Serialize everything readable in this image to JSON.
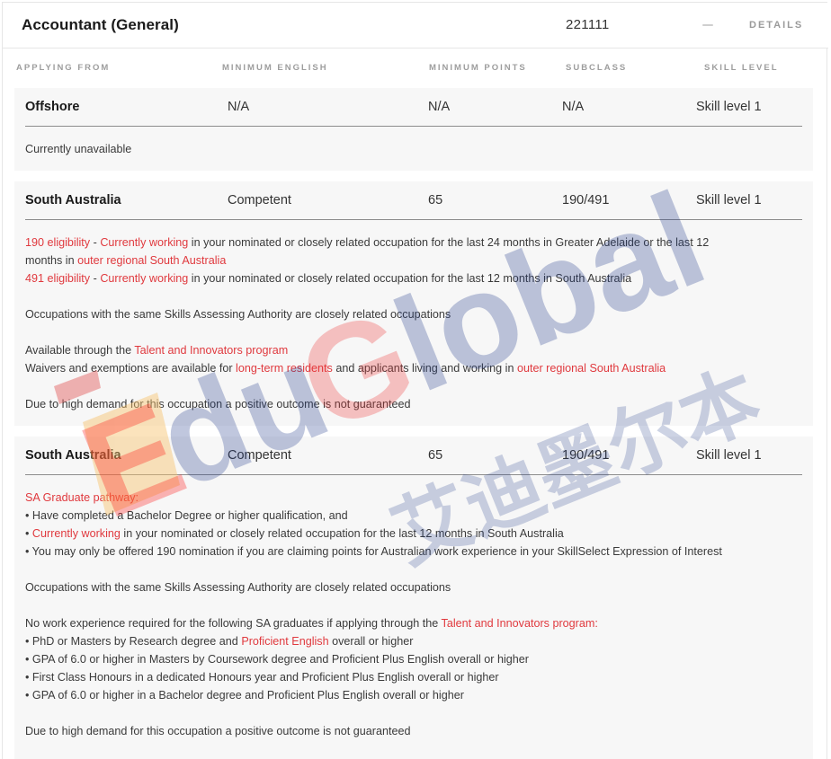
{
  "header": {
    "title": "Accountant (General)",
    "code": "221111",
    "details_label": "DETAILS"
  },
  "columns": [
    "APPLYING FROM",
    "MINIMUM ENGLISH",
    "MINIMUM POINTS",
    "SUBCLASS",
    "SKILL LEVEL"
  ],
  "cards": [
    {
      "location": "Offshore",
      "english": "N/A",
      "points": "N/A",
      "subclass": "N/A",
      "skill": "Skill level 1",
      "lines": [
        [
          {
            "t": "Currently unavailable"
          }
        ]
      ]
    },
    {
      "location": "South Australia",
      "english": "Competent",
      "points": "65",
      "subclass": "190/491",
      "skill": "Skill level 1",
      "lines": [
        [
          {
            "t": "190 eligibility",
            "r": true
          },
          {
            "t": " - "
          },
          {
            "t": "Currently working",
            "r": true
          },
          {
            "t": " in your nominated or closely related occupation for the last 24 months in Greater Adelaide or the last 12"
          }
        ],
        [
          {
            "t": "months in "
          },
          {
            "t": "outer regional South Australia",
            "r": true
          }
        ],
        [
          {
            "t": "491 eligibility",
            "r": true
          },
          {
            "t": " - "
          },
          {
            "t": "Currently working",
            "r": true
          },
          {
            "t": " in your nominated or closely related occupation for the last 12 months in South Australia"
          }
        ],
        [],
        [
          {
            "t": "Occupations with the same Skills Assessing Authority are closely related occupations"
          }
        ],
        [],
        [
          {
            "t": "Available through the "
          },
          {
            "t": "Talent and Innovators program",
            "r": true
          }
        ],
        [
          {
            "t": "Waivers and exemptions are available for "
          },
          {
            "t": "long-term residents",
            "r": true
          },
          {
            "t": " and applicants living and working in "
          },
          {
            "t": "outer regional South Australia",
            "r": true
          }
        ],
        [],
        [
          {
            "t": "Due to high demand for this occupation a positive outcome is not guaranteed"
          }
        ]
      ]
    },
    {
      "location": "South Australia",
      "english": "Competent",
      "points": "65",
      "subclass": "190/491",
      "skill": "Skill level 1",
      "lines": [
        [
          {
            "t": "SA Graduate pathway:",
            "r": true
          }
        ],
        [
          {
            "t": "• Have completed a Bachelor Degree or higher qualification, and"
          }
        ],
        [
          {
            "t": "• "
          },
          {
            "t": "Currently working",
            "r": true
          },
          {
            "t": " in your nominated or closely related occupation for the last 12 months in South Australia"
          }
        ],
        [
          {
            "t": "• You may only be offered 190 nomination if you are claiming points for Australian work experience in your SkillSelect Expression of Interest"
          }
        ],
        [],
        [
          {
            "t": "Occupations with the same Skills Assessing Authority are closely related occupations"
          }
        ],
        [],
        [
          {
            "t": "No work experience required for the following SA graduates if applying through the "
          },
          {
            "t": "Talent and Innovators program:",
            "r": true
          }
        ],
        [
          {
            "t": "• PhD or Masters by Research degree and "
          },
          {
            "t": "Proficient English",
            "r": true
          },
          {
            "t": " overall or higher"
          }
        ],
        [
          {
            "t": "• GPA of 6.0 or higher in Masters by Coursework degree and Proficient Plus English overall or higher"
          }
        ],
        [
          {
            "t": "• First Class Honours in a dedicated Honours year and Proficient Plus English overall or higher"
          }
        ],
        [
          {
            "t": "• GPA of 6.0 or higher in a Bachelor degree and Proficient Plus English overall or higher"
          }
        ],
        [],
        [
          {
            "t": "Due to high demand for this occupation a positive outcome is not guaranteed"
          }
        ]
      ]
    }
  ],
  "watermark": {
    "brand": "EduGlobal",
    "chinese": "艾迪墨尔本"
  }
}
